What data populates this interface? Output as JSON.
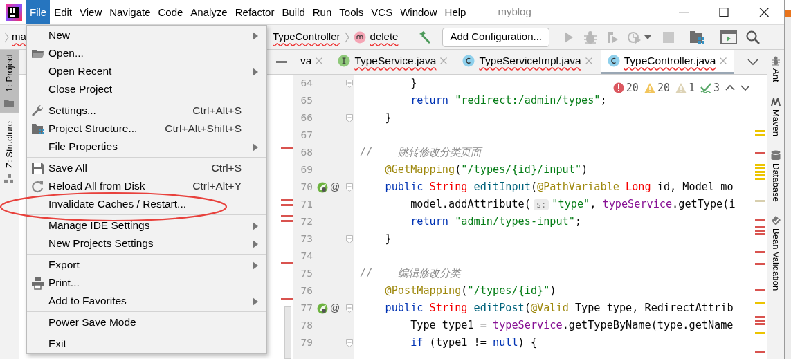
{
  "window": {
    "title": "myblog"
  },
  "menubar": [
    {
      "text": "File",
      "selected": true
    },
    {
      "text": "Edit",
      "selected": false
    },
    {
      "text": "View",
      "selected": false
    },
    {
      "text": "Navigate",
      "selected": false
    },
    {
      "text": "Code",
      "selected": false
    },
    {
      "text": "Analyze",
      "selected": false
    },
    {
      "text": "Refactor",
      "selected": false
    },
    {
      "text": "Build",
      "selected": false
    },
    {
      "text": "Run",
      "selected": false
    },
    {
      "text": "Tools",
      "selected": false
    },
    {
      "text": "VCS",
      "selected": false
    },
    {
      "text": "Window",
      "selected": false
    },
    {
      "text": "Help",
      "selected": false
    }
  ],
  "breadcrumbs": [
    {
      "text": "ma",
      "kind": "plain",
      "error": true
    },
    {
      "text": "TypeController",
      "kind": "plain",
      "error": true
    },
    {
      "text": "delete",
      "kind": "method",
      "error": true
    }
  ],
  "toolbar": {
    "run_config": "Add Configuration..."
  },
  "left_tool_windows": [
    {
      "text": "1: Project",
      "selected": true
    },
    {
      "text": "Z: Structure",
      "selected": false
    }
  ],
  "right_tool_windows": [
    {
      "text": "Ant"
    },
    {
      "text": "Maven"
    },
    {
      "text": "Database"
    },
    {
      "text": "Bean Validation"
    }
  ],
  "tabs": [
    {
      "text": "va",
      "kind": "plain",
      "error": false,
      "selected": false
    },
    {
      "text": "TypeService.java",
      "kind": "interface",
      "error": true,
      "selected": false
    },
    {
      "text": "TypeServiceImpl.java",
      "kind": "class",
      "error": true,
      "selected": false
    },
    {
      "text": "TypeController.java",
      "kind": "class",
      "error": true,
      "selected": true
    }
  ],
  "inspections": [
    {
      "kind": "error",
      "text": "20"
    },
    {
      "kind": "warning",
      "text": "20"
    },
    {
      "kind": "weak",
      "text": "1"
    },
    {
      "kind": "typo",
      "text": "3"
    }
  ],
  "lines": [
    {
      "number": "64",
      "fold": true,
      "mapping": false,
      "tokens": [
        {
          "kind": "plain",
          "text": "        }"
        }
      ]
    },
    {
      "number": "65",
      "fold": false,
      "mapping": false,
      "tokens": [
        {
          "kind": "keyword",
          "text": "        return "
        },
        {
          "kind": "string",
          "text": "\"redirect:/admin/types\""
        },
        {
          "kind": "plain",
          "text": ";"
        }
      ]
    },
    {
      "number": "66",
      "fold": true,
      "mapping": false,
      "tokens": [
        {
          "kind": "plain",
          "text": "    }"
        }
      ]
    },
    {
      "number": "67",
      "fold": false,
      "mapping": false
    },
    {
      "number": "68",
      "fold": false,
      "mapping": false,
      "tokens": [
        {
          "kind": "comment",
          "text": "//    跳转修改分类页面"
        }
      ]
    },
    {
      "number": "69",
      "fold": false,
      "mapping": false,
      "tokens": [
        {
          "kind": "annotation",
          "text": "    @GetMapping"
        },
        {
          "kind": "plain",
          "text": "("
        },
        {
          "kind": "string",
          "text": "\""
        },
        {
          "kind": "url",
          "text": "/types/{id}/input"
        },
        {
          "kind": "string",
          "text": "\""
        },
        {
          "kind": "plain",
          "text": ")"
        }
      ]
    },
    {
      "number": "70",
      "fold": true,
      "mapping": true,
      "mark": "@",
      "tokens": [
        {
          "kind": "keyword",
          "text": "    public "
        },
        {
          "kind": "type",
          "text": "String "
        },
        {
          "kind": "method",
          "text": "editInput"
        },
        {
          "kind": "plain",
          "text": "("
        },
        {
          "kind": "annotation",
          "text": "@PathVariable "
        },
        {
          "kind": "type",
          "text": "Long "
        },
        {
          "kind": "plain",
          "text": "id, Model mo"
        }
      ]
    },
    {
      "number": "71",
      "fold": false,
      "mapping": false,
      "tokens": [
        {
          "kind": "plain",
          "text": "        model.addAttribute("
        },
        {
          "kind": "hint",
          "text": "s:"
        },
        {
          "kind": "string",
          "text": "\"type\""
        },
        {
          "kind": "plain",
          "text": ", "
        },
        {
          "kind": "field",
          "text": "typeService"
        },
        {
          "kind": "plain",
          "text": ".getType(i"
        }
      ]
    },
    {
      "number": "72",
      "fold": false,
      "mapping": false,
      "tokens": [
        {
          "kind": "keyword",
          "text": "        return "
        },
        {
          "kind": "string",
          "text": "\"admin/types-input\""
        },
        {
          "kind": "plain",
          "text": ";"
        }
      ]
    },
    {
      "number": "73",
      "fold": true,
      "mapping": false,
      "tokens": [
        {
          "kind": "plain",
          "text": "    }"
        }
      ]
    },
    {
      "number": "74",
      "fold": false,
      "mapping": false
    },
    {
      "number": "75",
      "fold": false,
      "mapping": false,
      "tokens": [
        {
          "kind": "comment",
          "text": "//    编辑修改分类"
        }
      ]
    },
    {
      "number": "76",
      "fold": false,
      "mapping": false,
      "tokens": [
        {
          "kind": "annotation",
          "text": "    @PostMapping"
        },
        {
          "kind": "plain",
          "text": "("
        },
        {
          "kind": "string",
          "text": "\""
        },
        {
          "kind": "url",
          "text": "/types/{id}"
        },
        {
          "kind": "string",
          "text": "\""
        },
        {
          "kind": "plain",
          "text": ")"
        }
      ]
    },
    {
      "number": "77",
      "fold": true,
      "mapping": true,
      "mark": "@",
      "tokens": [
        {
          "kind": "keyword",
          "text": "    public "
        },
        {
          "kind": "type",
          "text": "String "
        },
        {
          "kind": "method",
          "text": "editPost"
        },
        {
          "kind": "plain",
          "text": "("
        },
        {
          "kind": "annotation",
          "text": "@Valid "
        },
        {
          "kind": "plain",
          "text": "Type type, RedirectAttrib"
        }
      ]
    },
    {
      "number": "78",
      "fold": false,
      "mapping": false,
      "tokens": [
        {
          "kind": "plain",
          "text": "        Type type1 = "
        },
        {
          "kind": "field",
          "text": "typeService"
        },
        {
          "kind": "plain",
          "text": ".getTypeByName(type.getName"
        }
      ]
    },
    {
      "number": "79",
      "fold": true,
      "mapping": false,
      "tokens": [
        {
          "kind": "keyword",
          "text": "        if "
        },
        {
          "kind": "plain",
          "text": "(type1 != "
        },
        {
          "kind": "keyword",
          "text": "null"
        },
        {
          "kind": "plain",
          "text": ") {"
        }
      ]
    }
  ],
  "menu": {
    "items": [
      {
        "kind": "submenu",
        "text": "New",
        "circled": false
      },
      {
        "kind": "action",
        "text": "Open...",
        "circled": false
      },
      {
        "kind": "submenu",
        "text": "Open Recent",
        "circled": false
      },
      {
        "kind": "action",
        "text": "Close Project",
        "circled": false
      },
      {
        "kind": "separator"
      },
      {
        "kind": "action",
        "text": "Settings...",
        "shortcut": "Ctrl+Alt+S",
        "circled": false
      },
      {
        "kind": "action",
        "text": "Project Structure...",
        "shortcut": "Ctrl+Alt+Shift+S",
        "circled": false
      },
      {
        "kind": "submenu",
        "text": "File Properties",
        "circled": false
      },
      {
        "kind": "separator"
      },
      {
        "kind": "action",
        "text": "Save All",
        "shortcut": "Ctrl+S",
        "circled": false
      },
      {
        "kind": "action",
        "text": "Reload All from Disk",
        "shortcut": "Ctrl+Alt+Y",
        "circled": false
      },
      {
        "kind": "action",
        "text": "Invalidate Caches / Restart...",
        "circled": true
      },
      {
        "kind": "separator"
      },
      {
        "kind": "submenu",
        "text": "Manage IDE Settings",
        "circled": false
      },
      {
        "kind": "submenu",
        "text": "New Projects Settings",
        "circled": false
      },
      {
        "kind": "separator"
      },
      {
        "kind": "submenu",
        "text": "Export",
        "circled": false
      },
      {
        "kind": "action",
        "text": "Print...",
        "circled": false
      },
      {
        "kind": "submenu",
        "text": "Add to Favorites",
        "circled": false
      },
      {
        "kind": "separator"
      },
      {
        "kind": "action",
        "text": "Power Save Mode",
        "circled": false
      },
      {
        "kind": "separator"
      },
      {
        "kind": "action",
        "text": "Exit",
        "circled": false
      }
    ]
  }
}
